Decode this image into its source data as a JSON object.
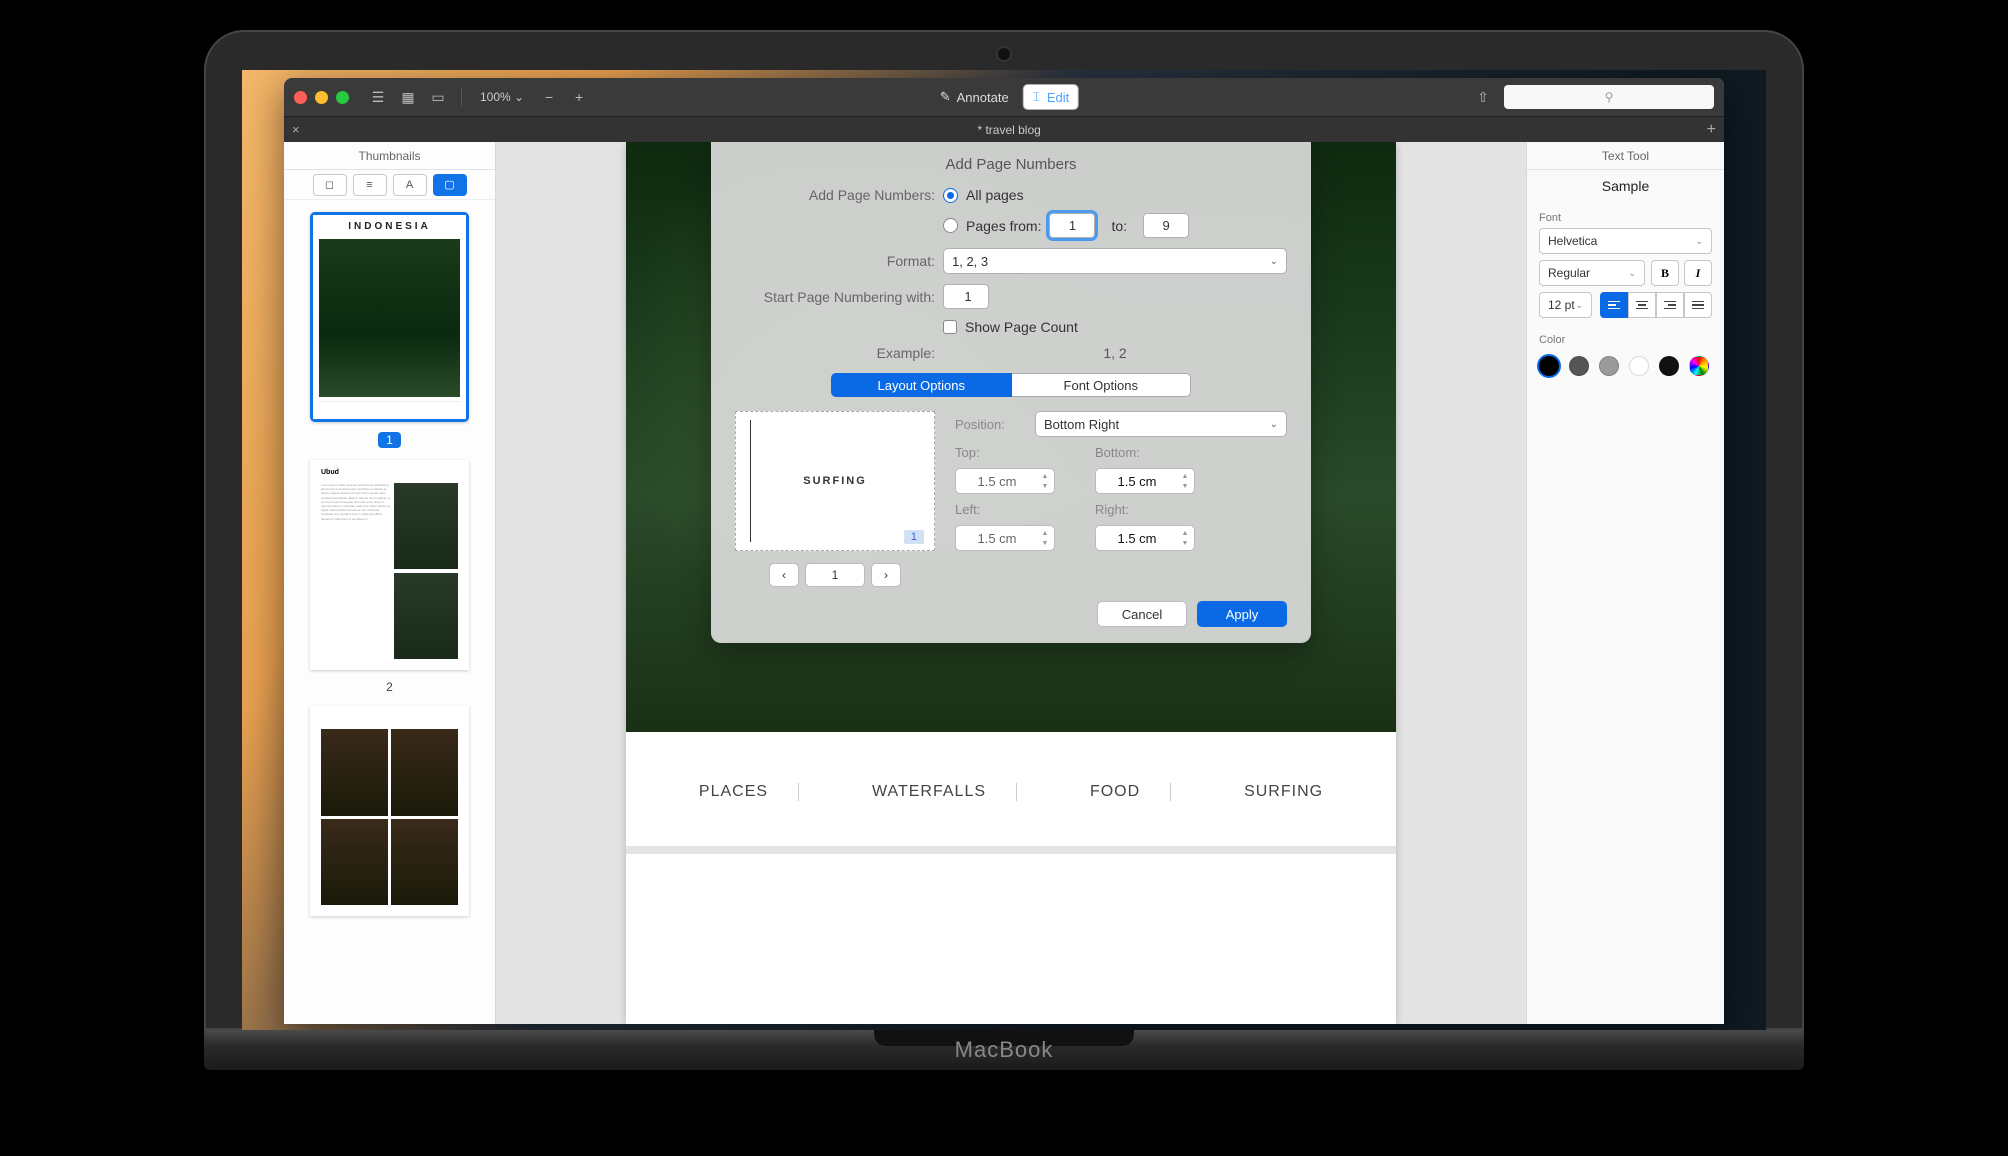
{
  "toolbar": {
    "zoom": "100% ⌄",
    "annotate": "Annotate",
    "edit": "Edit"
  },
  "tab": {
    "title": "* travel blog"
  },
  "sidebar": {
    "title": "Thumbnails",
    "pages": [
      "1",
      "2"
    ]
  },
  "thumb1_title": "INDONESIA",
  "doc_nav": [
    "PLACES",
    "WATERFALLS",
    "FOOD",
    "SURFING"
  ],
  "dialog": {
    "title": "Add Page Numbers",
    "lbl_add": "Add Page Numbers:",
    "all_pages": "All pages",
    "pages_from": "Pages from:",
    "from_val": "1",
    "to_lbl": "to:",
    "to_val": "9",
    "lbl_format": "Format:",
    "format_val": "1, 2, 3",
    "lbl_start": "Start Page Numbering with:",
    "start_val": "1",
    "show_count": "Show Page Count",
    "lbl_example": "Example:",
    "example_val": "1, 2",
    "tab_layout": "Layout Options",
    "tab_font": "Font Options",
    "preview_text": "SURFING",
    "preview_page": "1",
    "preview_cur": "1",
    "pos_lbl": "Position:",
    "pos_val": "Bottom Right",
    "top_lbl": "Top:",
    "top_val": "1.5 cm",
    "bot_lbl": "Bottom:",
    "bot_val": "1.5 cm",
    "left_lbl": "Left:",
    "left_val": "1.5 cm",
    "right_lbl": "Right:",
    "right_val": "1.5 cm",
    "cancel": "Cancel",
    "apply": "Apply"
  },
  "inspector": {
    "title": "Text Tool",
    "sample": "Sample",
    "font_lbl": "Font",
    "font": "Helvetica",
    "weight": "Regular",
    "size": "12 pt",
    "bold": "B",
    "italic": "I",
    "color_lbl": "Color",
    "colors": [
      "#000000",
      "#555555",
      "#9a9a9a",
      "#ffffff",
      "#111111",
      "rainbow"
    ]
  }
}
